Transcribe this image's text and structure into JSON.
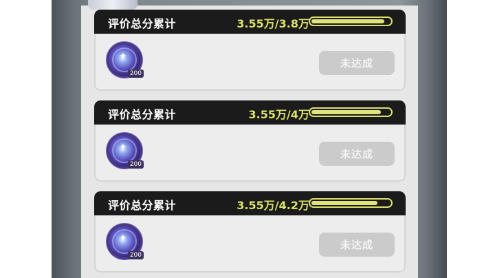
{
  "colors": {
    "header_bg": "#1b1b1b",
    "accent_yellow": "#dbe26a",
    "card_bg": "#ededed",
    "button_disabled": "#cbcbcb"
  },
  "cards": [
    {
      "title": "评价总分累计",
      "progress_text": "3.55万/3.8万",
      "progress_fraction": 0.934,
      "reward": {
        "icon": "purple-orb-icon",
        "quantity": "200"
      },
      "button_label": "未达成"
    },
    {
      "title": "评价总分累计",
      "progress_text": "3.55万/4万",
      "progress_fraction": 0.888,
      "reward": {
        "icon": "purple-orb-icon",
        "quantity": "200"
      },
      "button_label": "未达成"
    },
    {
      "title": "评价总分累计",
      "progress_text": "3.55万/4.2万",
      "progress_fraction": 0.845,
      "reward": {
        "icon": "purple-orb-icon",
        "quantity": "200"
      },
      "button_label": "未达成"
    }
  ]
}
